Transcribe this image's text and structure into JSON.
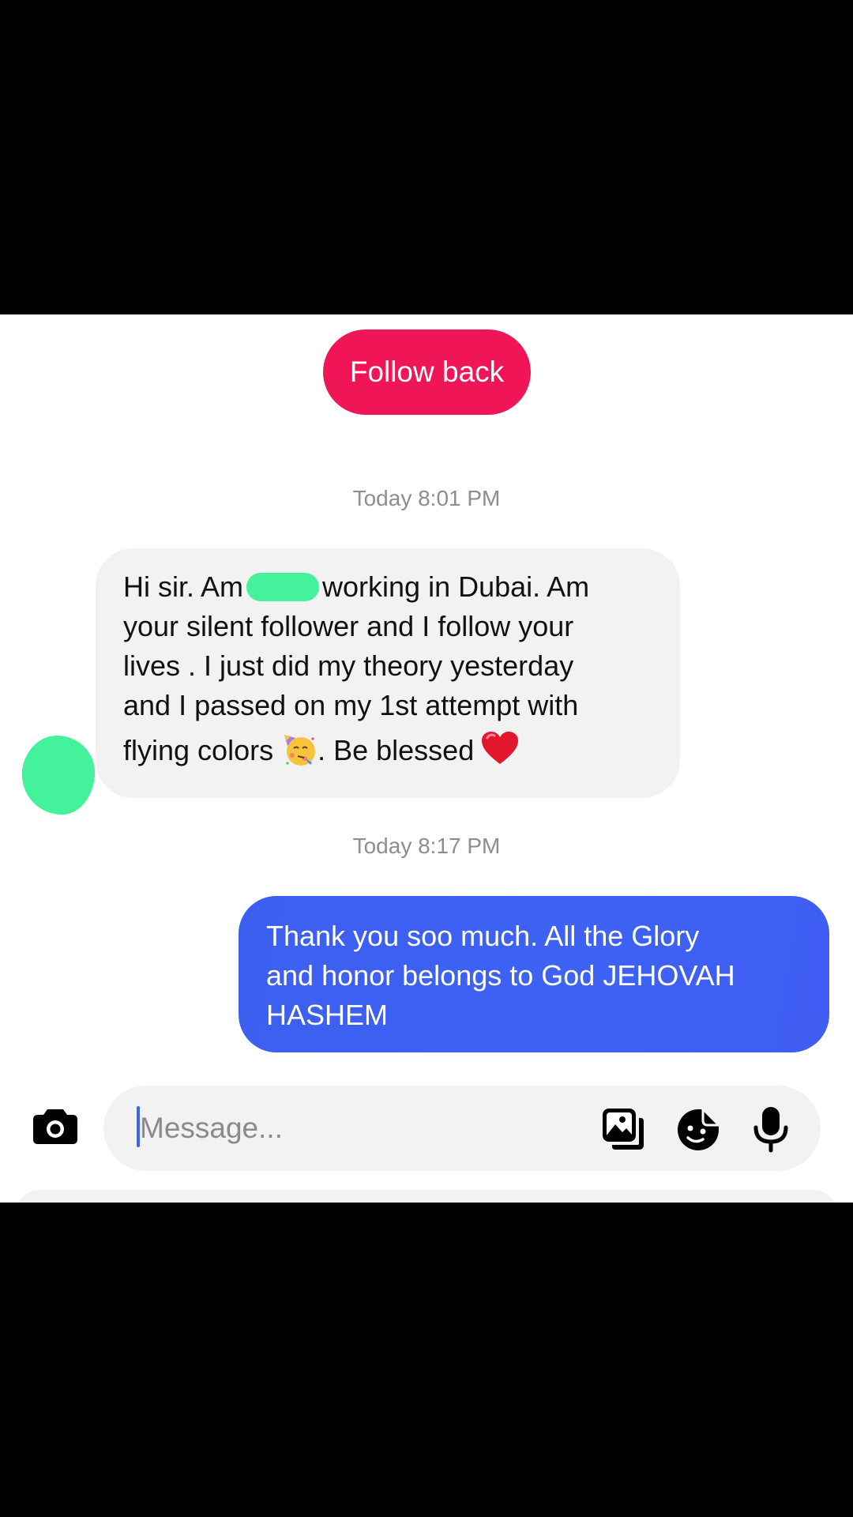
{
  "header": {
    "follow_back_label": "Follow back"
  },
  "conversation": {
    "timestamps": [
      "Today 8:01 PM",
      "Today 8:17 PM"
    ],
    "incoming_message": {
      "lines": [
        "Hi sir. Am",
        "working in Dubai. Am",
        "your silent follower and I follow your",
        "lives . I just did my theory yesterday",
        "and I passed on my 1st attempt with",
        "flying colors",
        ". Be blessed"
      ],
      "emojis": [
        "partying-face-emoji",
        "red-heart-emoji"
      ]
    },
    "outgoing_message": {
      "lines": [
        "Thank you soo much. All the Glory",
        "and honor belongs to God JEHOVAH",
        "HASHEM"
      ]
    }
  },
  "composer": {
    "placeholder": "Message...",
    "icons": [
      "camera-icon",
      "gallery-icon",
      "sticker-icon",
      "microphone-icon"
    ]
  },
  "colors": {
    "follow_back": "#ef1557",
    "outgoing_bubble": "#3d62f5",
    "incoming_bubble": "#f2f2f2",
    "redaction": "#43f29a",
    "timestamp_text": "#8e8e8e"
  }
}
